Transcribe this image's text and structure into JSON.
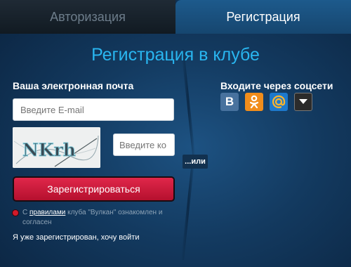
{
  "tabs": {
    "login": "Авторизация",
    "register": "Регистрация"
  },
  "form": {
    "title": "Регистрация в клубе",
    "email_label": "Ваша электронная почта",
    "email_placeholder": "Введите E-mail",
    "code_placeholder": "Введите ко",
    "captcha_text": "NKrh",
    "submit_label": "Зарегистрироваться",
    "agree_prefix": "С ",
    "agree_link": "правилами",
    "agree_suffix": " клуба \"Вулкан\" ознакомлен и согласен",
    "already_registered": "Я уже зарегистрирован, хочу войти"
  },
  "divider": {
    "label": "...или"
  },
  "social": {
    "title": "Входите через соцсети",
    "vk_icon_text": "B",
    "items": [
      {
        "name": "vkontakte-icon",
        "color": "#48729e"
      },
      {
        "name": "odnoklassniki-icon",
        "color": "#f18d1b"
      },
      {
        "name": "mailru-icon",
        "color": "#1d79cc"
      },
      {
        "name": "more-dropdown-icon",
        "color": "#2b2b2b"
      }
    ]
  },
  "colors": {
    "accent_title": "#29b6f0",
    "submit_button": "#d01c3c",
    "background": "#133a60"
  }
}
